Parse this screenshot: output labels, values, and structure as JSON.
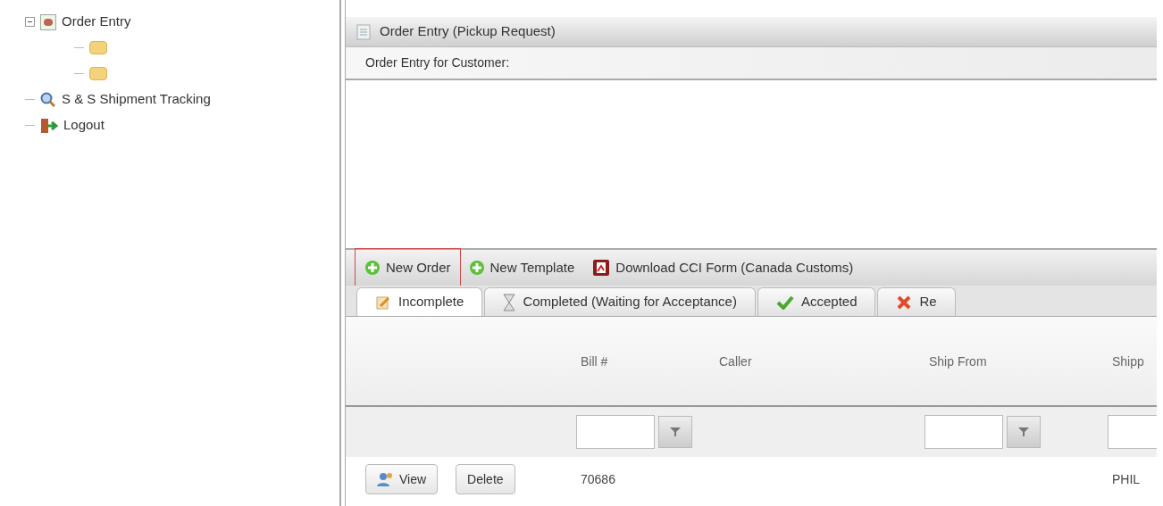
{
  "tree": [
    {
      "label": "Order Entry",
      "expanded": true,
      "children": [
        {
          "kind": "folder"
        },
        {
          "kind": "folder"
        }
      ]
    },
    {
      "label": "S & S Shipment Tracking"
    },
    {
      "label": "Logout"
    }
  ],
  "panel": {
    "title": "Order Entry (Pickup Request)",
    "subtitle": "Order Entry for Customer:"
  },
  "toolbar": [
    {
      "label": "New Order",
      "highlighted": true
    },
    {
      "label": "New Template",
      "highlighted": false
    },
    {
      "label": "Download CCI Form (Canada Customs)",
      "highlighted": false
    }
  ],
  "tabs": [
    {
      "label": "Incomplete",
      "selected": true
    },
    {
      "label": "Completed (Waiting for Acceptance)",
      "selected": false
    },
    {
      "label": "Accepted",
      "selected": false
    },
    {
      "label": "Re",
      "selected": false
    }
  ],
  "table": {
    "columns": [
      {
        "filter": false
      },
      {
        "label": "Bill #",
        "filter": true
      },
      {
        "label": "Caller",
        "filter": false
      },
      {
        "label": "Ship From",
        "filter": true
      },
      {
        "label": "Shipp",
        "filter": true
      }
    ],
    "rows": [
      {
        "actions": [
          "View",
          "Delete"
        ],
        "cells": [
          "",
          "70686",
          "",
          "",
          "PHIL"
        ]
      }
    ]
  }
}
